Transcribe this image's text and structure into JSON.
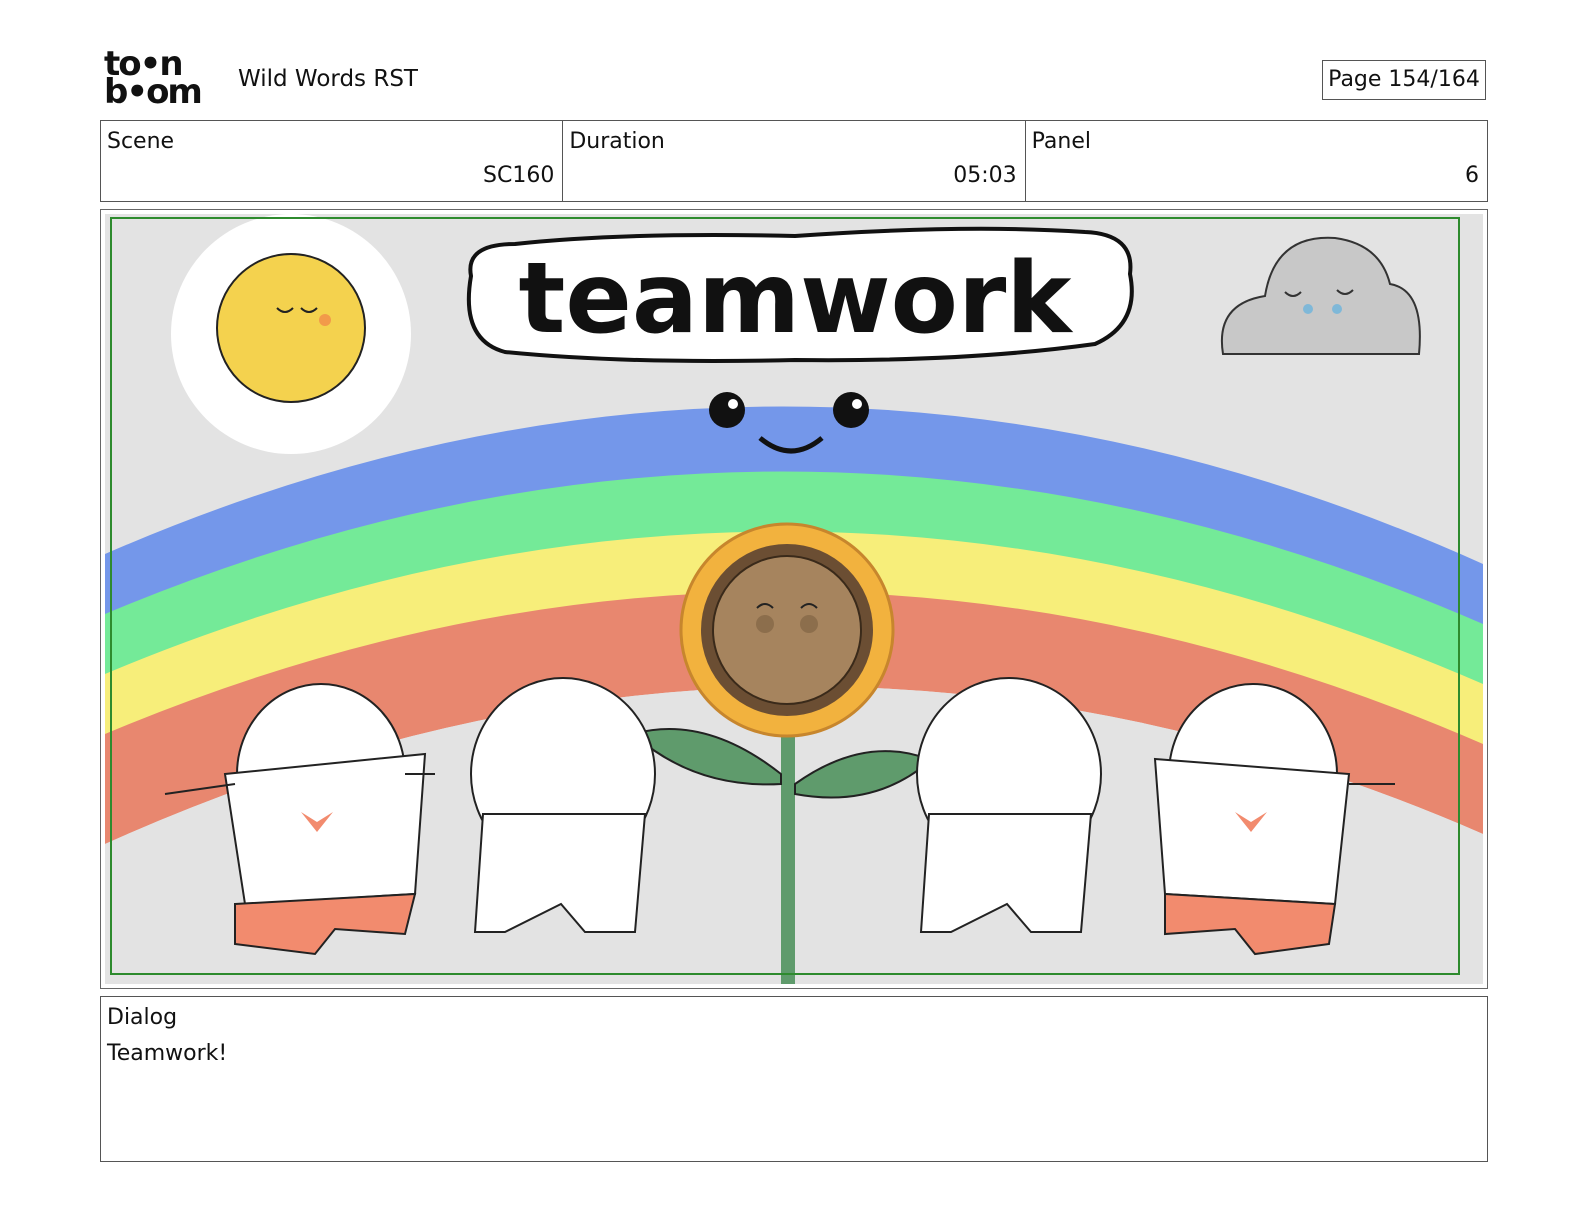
{
  "header": {
    "logo_line1": "to•n",
    "logo_line2": "b•om",
    "project_title": "Wild Words RST",
    "page_label": "Page 154/164"
  },
  "info": {
    "scene_label": "Scene",
    "scene_value": "SC160",
    "duration_label": "Duration",
    "duration_value": "05:03",
    "panel_label": "Panel",
    "panel_value": "6"
  },
  "panel_art": {
    "title_text": "teamwork",
    "colors": {
      "background": "#e3e3e3",
      "safe_frame": "#2e8b2e",
      "rainbow_blue": "#7497ea",
      "rainbow_green": "#74ea98",
      "rainbow_yellow": "#f7ee7a",
      "rainbow_red": "#e8876f",
      "sun": "#f4d24e",
      "cloud": "#c8c8c8",
      "sunflower_petals": "#f2b23e",
      "sunflower_center": "#a6845e",
      "leaf": "#5f9b6c",
      "pants": "#f28b6e"
    }
  },
  "dialog": {
    "label": "Dialog",
    "text": "Teamwork!"
  }
}
